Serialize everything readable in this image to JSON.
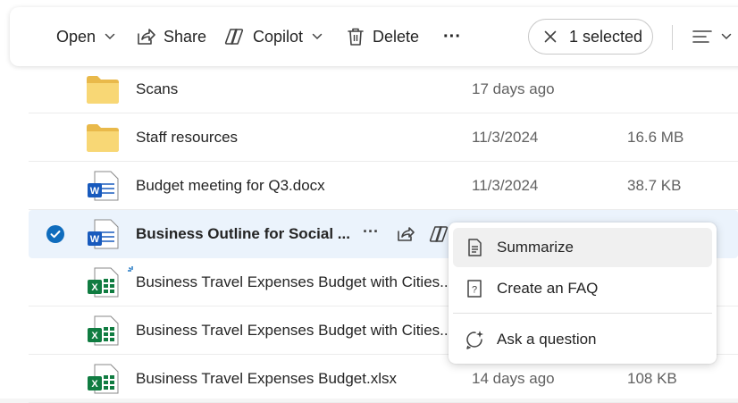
{
  "toolbar": {
    "open_label": "Open",
    "share_label": "Share",
    "copilot_label": "Copilot",
    "delete_label": "Delete",
    "more_label": "···",
    "selection_label": "1 selected"
  },
  "files": [
    {
      "name": "Scans",
      "modified": "17 days ago",
      "size": "",
      "type": "folder-icon"
    },
    {
      "name": "Staff resources",
      "modified": "11/3/2024",
      "size": "16.6 MB",
      "type": "folder-icon"
    },
    {
      "name": "Budget meeting for Q3.docx",
      "modified": "11/3/2024",
      "size": "38.7 KB",
      "type": "word-icon"
    },
    {
      "name": "Business Outline for Social ...",
      "modified": "",
      "size": "",
      "type": "word-icon",
      "selected": true
    },
    {
      "name": "Business Travel Expenses Budget with Cities...",
      "modified": "",
      "size": "",
      "type": "excel-icon",
      "new": true
    },
    {
      "name": "Business Travel Expenses Budget with Cities...",
      "modified": "",
      "size": "",
      "type": "excel-icon"
    },
    {
      "name": "Business Travel Expenses Budget.xlsx",
      "modified": "14 days ago",
      "size": "108 KB",
      "type": "excel-icon"
    }
  ],
  "row_actions": {
    "more_label": "···"
  },
  "copilot_menu": {
    "items": [
      {
        "label": "Summarize",
        "icon": "document-summary-icon"
      },
      {
        "label": "Create an FAQ",
        "icon": "faq-icon"
      },
      {
        "label": "Ask a question",
        "icon": "chat-sparkle-icon"
      }
    ]
  },
  "colors": {
    "accent": "#0f6cbd",
    "selected_row": "#ebf3fc",
    "folder": "#f8d775",
    "word": "#185abd",
    "excel": "#107c41"
  }
}
